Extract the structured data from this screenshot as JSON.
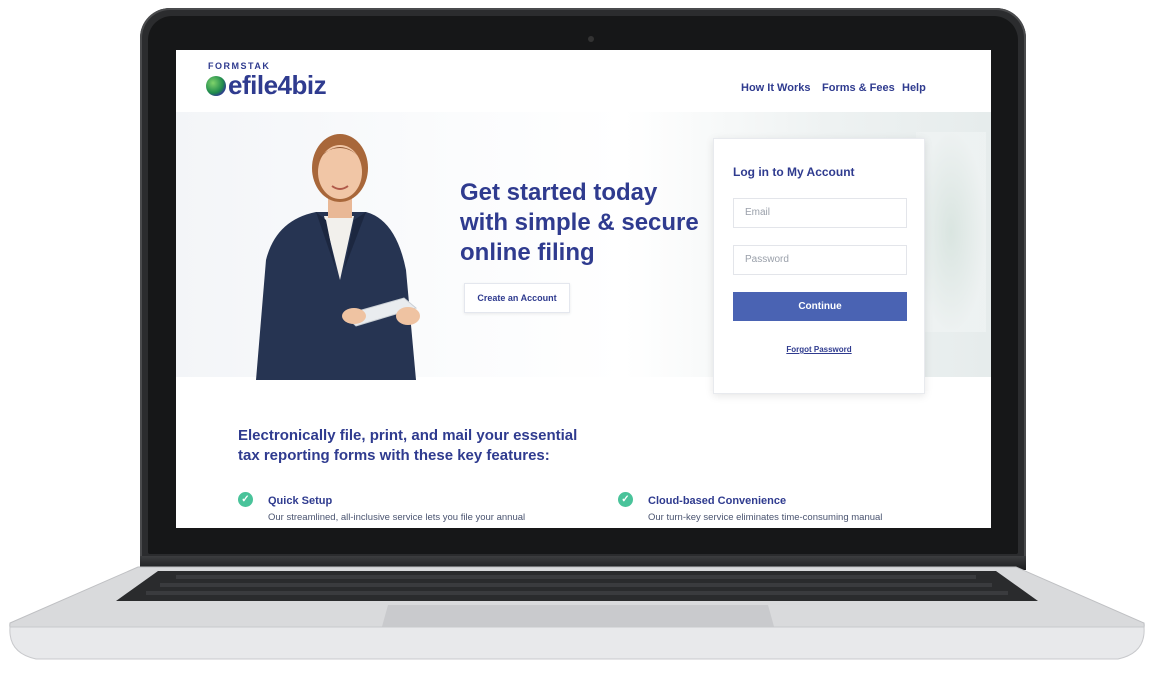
{
  "brand": {
    "company": "FORMSTAK",
    "product": "efile4biz"
  },
  "nav": {
    "items": [
      "How It Works",
      "Forms & Fees",
      "Help"
    ]
  },
  "hero": {
    "headline": "Get started today with simple & secure online filing",
    "create_account_label": "Create an Account"
  },
  "login": {
    "title": "Log in to My Account",
    "email_placeholder": "Email",
    "password_placeholder": "Password",
    "continue_label": "Continue",
    "forgot_label": "Forgot Password"
  },
  "features": {
    "title": "Electronically file, print, and mail your essential tax reporting forms with these key features:",
    "items": [
      {
        "title": "Quick Setup",
        "desc": "Our streamlined, all-inclusive service lets you file your annual"
      },
      {
        "title": "Cloud-based Convenience",
        "desc": "Our turn-key service eliminates time-consuming manual"
      }
    ]
  },
  "colors": {
    "brand_blue": "#2f3b8f",
    "button_blue": "#4a63b3",
    "check_green": "#49c39a"
  },
  "icons": {
    "feature_check": "check-circle-icon"
  }
}
